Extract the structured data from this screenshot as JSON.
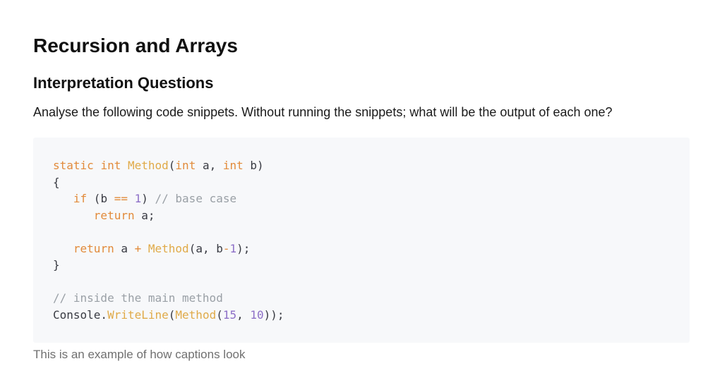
{
  "title": "Recursion and Arrays",
  "subtitle": "Interpretation Questions",
  "intro": "Analyse the following code snippets. Without running the snippets; what will be the output of each one?",
  "code": {
    "l1": {
      "kw1": "static",
      "kw2": "int",
      "fn": "Method",
      "p1": "(",
      "kw3": "int",
      "a": " a, ",
      "kw4": "int",
      "b": " b)"
    },
    "l2": "{",
    "l3": {
      "kw": "if",
      "cond1": " (b ",
      "op": "==",
      "sp": " ",
      "num": "1",
      "close": ") ",
      "comment": "// base case"
    },
    "l4": {
      "kw": "return",
      "rest": " a;"
    },
    "l6": {
      "kw": "return",
      "a": " a ",
      "op": "+",
      "sp": " ",
      "fn": "Method",
      "args1": "(a, b",
      "op2": "-",
      "num": "1",
      "end": ");"
    },
    "l7": "}",
    "l9": "// inside the main method",
    "l10": {
      "obj": "Console.",
      "fn1": "WriteLine",
      "p1": "(",
      "fn2": "Method",
      "p2": "(",
      "n1": "15",
      "comma": ", ",
      "n2": "10",
      "end": "));"
    }
  },
  "caption": "This is an example of how captions look"
}
